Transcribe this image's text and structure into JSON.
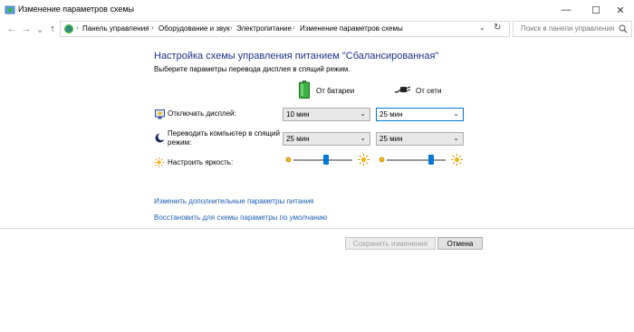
{
  "window": {
    "title": "Изменение параметров схемы",
    "minimize_glyph": "—",
    "maximize_glyph": "☐",
    "close_glyph": "✕"
  },
  "nav": {
    "back_glyph": "←",
    "forward_glyph": "→",
    "recent_glyph": "⌄",
    "up_glyph": "↑"
  },
  "address": {
    "breadcrumbs": [
      "Панель управления",
      "Оборудование и звук",
      "Электропитание",
      "Изменение параметров схемы"
    ],
    "separator": "›",
    "dropdown_glyph": "⌄",
    "refresh_glyph": "↻"
  },
  "search": {
    "placeholder": "Поиск в панели управления"
  },
  "main": {
    "heading": "Настройка схемы управления питанием \"Сбалансированная\"",
    "subheading": "Выберите параметры перевода дисплея в спящий режим.",
    "columns": {
      "battery": "От батареи",
      "ac": "От сети"
    },
    "rows": {
      "display_off": {
        "label": "Отключать дисплей:",
        "battery_value": "10 мин",
        "ac_value": "25 мин"
      },
      "sleep": {
        "label_line1": "Переводить компьютер в спящий",
        "label_line2": "режим:",
        "battery_value": "25 мин",
        "ac_value": "25 мин"
      },
      "brightness": {
        "label": "Настроить яркость:",
        "battery_level": 0.55,
        "ac_level": 0.75
      }
    },
    "links": {
      "advanced": "Изменить дополнительные параметры питания",
      "restore": "Восстановить для схемы параметры по умолчанию"
    },
    "buttons": {
      "save": "Сохранить изменения",
      "cancel": "Отмена"
    }
  },
  "colors": {
    "heading": "#1e3287",
    "link": "#1e5fb4",
    "accent": "#0078d7"
  }
}
